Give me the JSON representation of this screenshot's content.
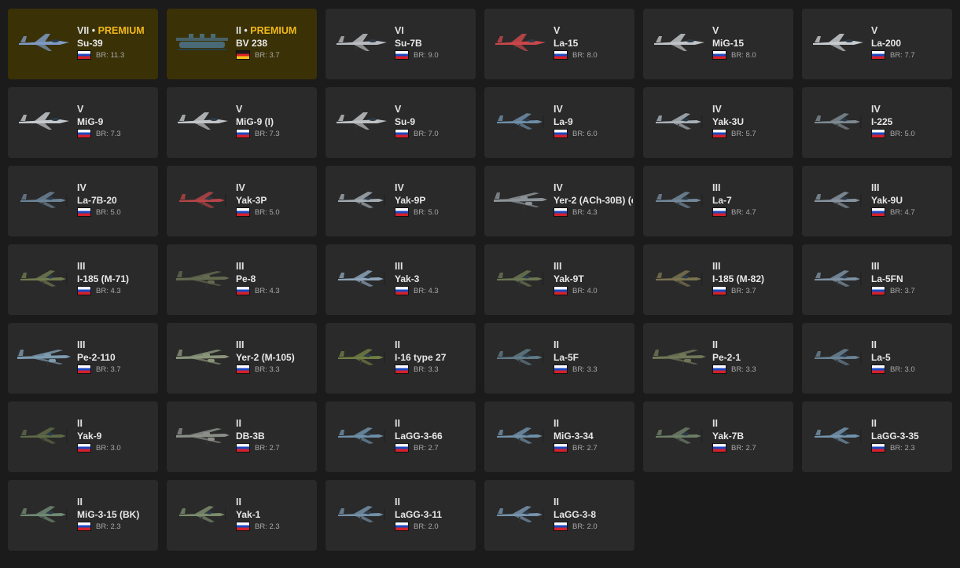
{
  "vehicles": [
    {
      "tier": "VII",
      "premium_label": "PREMIUM",
      "name": "Su-39",
      "flag": "ussr",
      "br": "BR: 11.3",
      "color": "#7f9bc4",
      "type": "jet"
    },
    {
      "tier": "II",
      "premium_label": "PREMIUM",
      "name": "BV 238",
      "flag": "germany",
      "br": "BR: 3.7",
      "color": "#4a6a78",
      "type": "boat"
    },
    {
      "tier": "VI",
      "name": "Su-7B",
      "flag": "ussr",
      "br": "BR: 9.0",
      "color": "#b8bcc0",
      "type": "jet"
    },
    {
      "tier": "V",
      "name": "La-15",
      "flag": "ussr",
      "br": "BR: 8.0",
      "color": "#c9474a",
      "type": "jet"
    },
    {
      "tier": "V",
      "name": "MiG-15",
      "flag": "ussr",
      "br": "BR: 8.0",
      "color": "#c0c4c8",
      "type": "jet"
    },
    {
      "tier": "V",
      "name": "La-200",
      "flag": "ussr",
      "br": "BR: 7.7",
      "color": "#c8cccf",
      "type": "jet"
    },
    {
      "tier": "V",
      "name": "MiG-9",
      "flag": "ussr",
      "br": "BR: 7.3",
      "color": "#c6c9cc",
      "type": "jet"
    },
    {
      "tier": "V",
      "name": "MiG-9 (I)",
      "flag": "ussr",
      "br": "BR: 7.3",
      "color": "#c2c5c8",
      "type": "jet"
    },
    {
      "tier": "V",
      "name": "Su-9",
      "flag": "ussr",
      "br": "BR: 7.0",
      "color": "#bfc2c4",
      "type": "jet"
    },
    {
      "tier": "IV",
      "name": "La-9",
      "flag": "ussr",
      "br": "BR: 6.0",
      "color": "#6e8ea8",
      "type": "prop"
    },
    {
      "tier": "IV",
      "name": "Yak-3U",
      "flag": "ussr",
      "br": "BR: 5.7",
      "color": "#a9b1b8",
      "type": "prop"
    },
    {
      "tier": "IV",
      "name": "I-225",
      "flag": "ussr",
      "br": "BR: 5.0",
      "color": "#7d8a92",
      "type": "prop"
    },
    {
      "tier": "IV",
      "name": "La-7B-20",
      "flag": "ussr",
      "br": "BR: 5.0",
      "color": "#6b8296",
      "type": "prop"
    },
    {
      "tier": "IV",
      "name": "Yak-3P",
      "flag": "ussr",
      "br": "BR: 5.0",
      "color": "#b64446",
      "type": "prop"
    },
    {
      "tier": "IV",
      "name": "Yak-9P",
      "flag": "ussr",
      "br": "BR: 5.0",
      "color": "#a3abb2",
      "type": "prop"
    },
    {
      "tier": "IV",
      "name": "Yer-2 (ACh-30B) (e",
      "flag": "ussr",
      "br": "BR: 4.3",
      "color": "#8c9398",
      "type": "bomber"
    },
    {
      "tier": "III",
      "name": "La-7",
      "flag": "ussr",
      "br": "BR: 4.7",
      "color": "#73889a",
      "type": "prop"
    },
    {
      "tier": "III",
      "name": "Yak-9U",
      "flag": "ussr",
      "br": "BR: 4.7",
      "color": "#8794a0",
      "type": "prop"
    },
    {
      "tier": "III",
      "name": "I-185 (M-71)",
      "flag": "ussr",
      "br": "BR: 4.3",
      "color": "#6f7a4f",
      "type": "prop"
    },
    {
      "tier": "III",
      "name": "Pe-8",
      "flag": "ussr",
      "br": "BR: 4.3",
      "color": "#62694f",
      "type": "bomber"
    },
    {
      "tier": "III",
      "name": "Yak-3",
      "flag": "ussr",
      "br": "BR: 4.3",
      "color": "#8da3b8",
      "type": "prop"
    },
    {
      "tier": "III",
      "name": "Yak-9T",
      "flag": "ussr",
      "br": "BR: 4.0",
      "color": "#6a7552",
      "type": "prop"
    },
    {
      "tier": "III",
      "name": "I-185 (M-82)",
      "flag": "ussr",
      "br": "BR: 3.7",
      "color": "#7a7350",
      "type": "prop"
    },
    {
      "tier": "III",
      "name": "La-5FN",
      "flag": "ussr",
      "br": "BR: 3.7",
      "color": "#7d91a3",
      "type": "prop"
    },
    {
      "tier": "III",
      "name": "Pe-2-110",
      "flag": "ussr",
      "br": "BR: 3.7",
      "color": "#7d9aae",
      "type": "bomber"
    },
    {
      "tier": "III",
      "name": "Yer-2 (M-105)",
      "flag": "ussr",
      "br": "BR: 3.3",
      "color": "#8a947a",
      "type": "bomber"
    },
    {
      "tier": "II",
      "name": "I-16 type 27",
      "flag": "ussr",
      "br": "BR: 3.3",
      "color": "#6f7d43",
      "type": "prop"
    },
    {
      "tier": "II",
      "name": "La-5F",
      "flag": "ussr",
      "br": "BR: 3.3",
      "color": "#5f7a86",
      "type": "prop"
    },
    {
      "tier": "II",
      "name": "Pe-2-1",
      "flag": "ussr",
      "br": "BR: 3.3",
      "color": "#6f7758",
      "type": "bomber"
    },
    {
      "tier": "II",
      "name": "La-5",
      "flag": "ussr",
      "br": "BR: 3.0",
      "color": "#6a8294",
      "type": "prop"
    },
    {
      "tier": "II",
      "name": "Yak-9",
      "flag": "ussr",
      "br": "BR: 3.0",
      "color": "#5e6a48",
      "type": "prop"
    },
    {
      "tier": "II",
      "name": "DB-3B",
      "flag": "ussr",
      "br": "BR: 2.7",
      "color": "#8a8f88",
      "type": "bomber"
    },
    {
      "tier": "II",
      "name": "LaGG-3-66",
      "flag": "ussr",
      "br": "BR: 2.7",
      "color": "#6d8fa8",
      "type": "prop"
    },
    {
      "tier": "II",
      "name": "MiG-3-34",
      "flag": "ussr",
      "br": "BR: 2.7",
      "color": "#7190a8",
      "type": "prop"
    },
    {
      "tier": "II",
      "name": "Yak-7B",
      "flag": "ussr",
      "br": "BR: 2.7",
      "color": "#6d7f66",
      "type": "prop"
    },
    {
      "tier": "II",
      "name": "LaGG-3-35",
      "flag": "ussr",
      "br": "BR: 2.3",
      "color": "#7394ae",
      "type": "prop"
    },
    {
      "tier": "II",
      "name": "MiG-3-15 (BK)",
      "flag": "ussr",
      "br": "BR: 2.3",
      "color": "#6f8a74",
      "type": "prop"
    },
    {
      "tier": "II",
      "name": "Yak-1",
      "flag": "ussr",
      "br": "BR: 2.3",
      "color": "#7b8c6c",
      "type": "prop"
    },
    {
      "tier": "II",
      "name": "LaGG-3-11",
      "flag": "ussr",
      "br": "BR: 2.0",
      "color": "#7390a8",
      "type": "prop"
    },
    {
      "tier": "II",
      "name": "LaGG-3-8",
      "flag": "ussr",
      "br": "BR: 2.0",
      "color": "#7693ab",
      "type": "prop"
    }
  ]
}
